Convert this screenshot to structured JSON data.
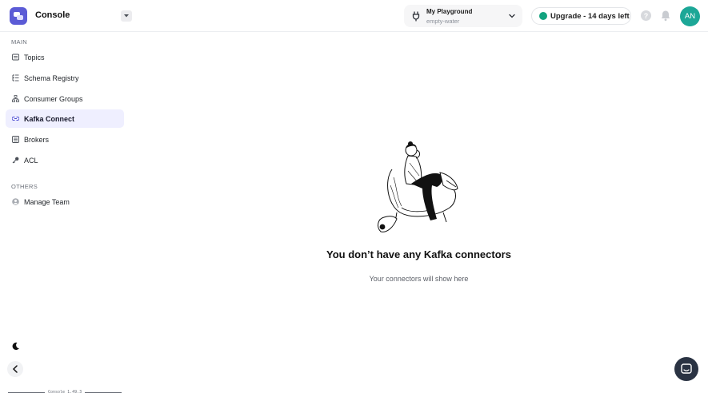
{
  "header": {
    "app_title": "Console",
    "project_name": "My Playground",
    "project_sub": "empty-water",
    "upgrade_label": "Upgrade - 14 days left",
    "help_label": "?",
    "avatar_initials": "AN"
  },
  "sidebar": {
    "main_label": "MAIN",
    "others_label": "OTHERS",
    "items": [
      {
        "label": "Topics",
        "icon": "list-icon"
      },
      {
        "label": "Schema Registry",
        "icon": "tree-list-icon"
      },
      {
        "label": "Consumer Groups",
        "icon": "hierarchy-icon"
      },
      {
        "label": "Kafka Connect",
        "icon": "connect-icon",
        "active": true
      },
      {
        "label": "Brokers",
        "icon": "server-icon"
      },
      {
        "label": "ACL",
        "icon": "key-icon"
      }
    ],
    "others": [
      {
        "label": "Manage Team",
        "icon": "user-icon"
      }
    ],
    "version": "Console 1.49.3"
  },
  "main": {
    "empty_title": "You don’t have any Kafka connectors",
    "empty_subtitle": "Your connectors will show here"
  },
  "colors": {
    "brand": "#5b5bd6",
    "status_dot": "#12a37f",
    "avatar": "#1ca797",
    "active_nav_bg": "#efefff"
  }
}
